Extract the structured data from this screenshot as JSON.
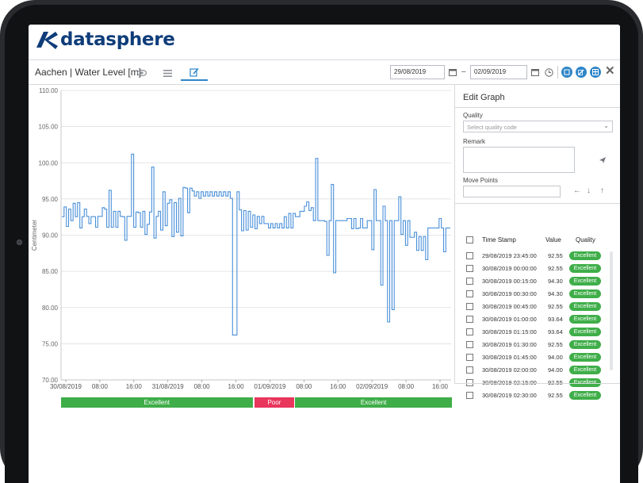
{
  "app": {
    "brand": "datasphere"
  },
  "toolbar": {
    "series_title": "Aachen | Water Level [m]",
    "date_from": "29/08/2019",
    "date_to": "02/09/2019",
    "date_separator": "–"
  },
  "colors": {
    "accent": "#2f86c9",
    "brand": "#0f3d7a",
    "excellent": "#3fae49",
    "poor": "#e8365d",
    "line": "#4a90d9"
  },
  "icons": [
    "eye-icon",
    "list-icon",
    "edit-icon",
    "calendar-icon",
    "clock-icon",
    "settings-icon",
    "table-icon",
    "close-icon",
    "send-icon",
    "arrow-left-icon",
    "arrow-down-icon",
    "arrow-up-icon",
    "chevron-down-icon"
  ],
  "chart_data": {
    "type": "line",
    "ylabel": "Centimeter",
    "ylim": [
      70,
      110
    ],
    "yticks": [
      "110.00",
      "105.00",
      "100.00",
      "95.00",
      "90.00",
      "85.00",
      "80.00",
      "75.00",
      "70.00"
    ],
    "xticks": [
      "30/08/2019",
      "08:00",
      "16:00",
      "31/08/2019",
      "08:00",
      "16:00",
      "01/09/2019",
      "08:00",
      "16:00",
      "02/09/2019",
      "08:00",
      "16:00"
    ],
    "grid": true,
    "series": [
      {
        "values": [
          92.55,
          93.9,
          91.2,
          93.6,
          92.0,
          94.4,
          92.55,
          94.5,
          91.0,
          92.55,
          93.6,
          92.6,
          91.6,
          92.55,
          92.55,
          91.1,
          92.6,
          92.6,
          93.8,
          93.6,
          91.1,
          96.2,
          91.1,
          93.3,
          91.1,
          93.3,
          92.6,
          92.55,
          89.3,
          92.6,
          92.6,
          101.2,
          91.1,
          93.2,
          93.1,
          91.1,
          93.3,
          90.1,
          91.5,
          93.2,
          99.4,
          89.6,
          92.6,
          93.3,
          90.7,
          96.0,
          91.3,
          94.4,
          94.9,
          89.8,
          94.5,
          90.4,
          95.1,
          89.9,
          96.6,
          96.5,
          93.1,
          96.5,
          96.1,
          95.4,
          96.0,
          95.1,
          96.0,
          95.4,
          96.0,
          95.4,
          96.0,
          95.4,
          96.0,
          95.4,
          96.0,
          95.4,
          96.0,
          95.4,
          96.0,
          95.1,
          76.2,
          76.2,
          96.0,
          93.5,
          90.6,
          93.4,
          90.7,
          93.3,
          91.1,
          92.8,
          90.9,
          92.6,
          91.6,
          92.6,
          91.6,
          91.6,
          91.0,
          91.6,
          91.0,
          91.6,
          91.0,
          91.6,
          91.0,
          92.55,
          91.0,
          93.0,
          91.0,
          93.0,
          92.55,
          92.55,
          93.3,
          93.3,
          94.0,
          94.6,
          93.4,
          93.8,
          92.0,
          100.6,
          92.0,
          92.0,
          92.0,
          91.9,
          87.2,
          92.0,
          97.0,
          84.8,
          92.0,
          92.0,
          92.0,
          92.0,
          92.0,
          92.3,
          92.3,
          90.9,
          92.3,
          90.9,
          91.0,
          92.3,
          91.0,
          91.0,
          92.0,
          92.0,
          88.0,
          96.3,
          92.0,
          92.0,
          83.1,
          94.0,
          92.0,
          78.0,
          92.0,
          79.7,
          92.0,
          92.0,
          95.3,
          90.1,
          92.0,
          88.6,
          92.0,
          89.7,
          89.7,
          90.4,
          87.9,
          89.8,
          87.9,
          89.8,
          86.6,
          91.0,
          91.0,
          91.0,
          91.0,
          91.0,
          92.3,
          91.0,
          87.7,
          91.0,
          91.0
        ]
      }
    ]
  },
  "quality_segments": [
    {
      "label": "Excellent",
      "status": "excellent",
      "from": 0,
      "to": 0.492
    },
    {
      "label": "Poor",
      "status": "poor",
      "from": 0.492,
      "to": 0.597
    },
    {
      "label": "Excellent",
      "status": "excellent",
      "from": 0.597,
      "to": 1.0
    }
  ],
  "panel": {
    "title": "Edit Graph",
    "quality_label": "Quality",
    "quality_placeholder": "Select quality code",
    "remark_label": "Remark",
    "move_label": "Move Points",
    "table_headers": {
      "timestamp": "Time Stamp",
      "value": "Value",
      "quality": "Quality"
    },
    "rows": [
      {
        "timestamp": "29/08/2019  23:45:00",
        "value": "92.55",
        "quality": "Excellent"
      },
      {
        "timestamp": "30/08/2019  00:00:00",
        "value": "92.55",
        "quality": "Excellent"
      },
      {
        "timestamp": "30/08/2019  00:15:00",
        "value": "94.30",
        "quality": "Excellent"
      },
      {
        "timestamp": "30/08/2019  00:30:00",
        "value": "94.30",
        "quality": "Excellent"
      },
      {
        "timestamp": "30/08/2019  00:45:00",
        "value": "92.55",
        "quality": "Excellent"
      },
      {
        "timestamp": "30/08/2019  01:00:00",
        "value": "93.64",
        "quality": "Excellent"
      },
      {
        "timestamp": "30/08/2019  01:15:00",
        "value": "93.64",
        "quality": "Excellent"
      },
      {
        "timestamp": "30/08/2019  01:30:00",
        "value": "92.55",
        "quality": "Excellent"
      },
      {
        "timestamp": "30/08/2019  01:45:00",
        "value": "94.00",
        "quality": "Excellent"
      },
      {
        "timestamp": "30/08/2019  02:00:00",
        "value": "94.00",
        "quality": "Excellent"
      },
      {
        "timestamp": "30/08/2019  02:15:00",
        "value": "92.55",
        "quality": "Excellent"
      },
      {
        "timestamp": "30/08/2019  02:30:00",
        "value": "92.55",
        "quality": "Excellent"
      }
    ]
  }
}
